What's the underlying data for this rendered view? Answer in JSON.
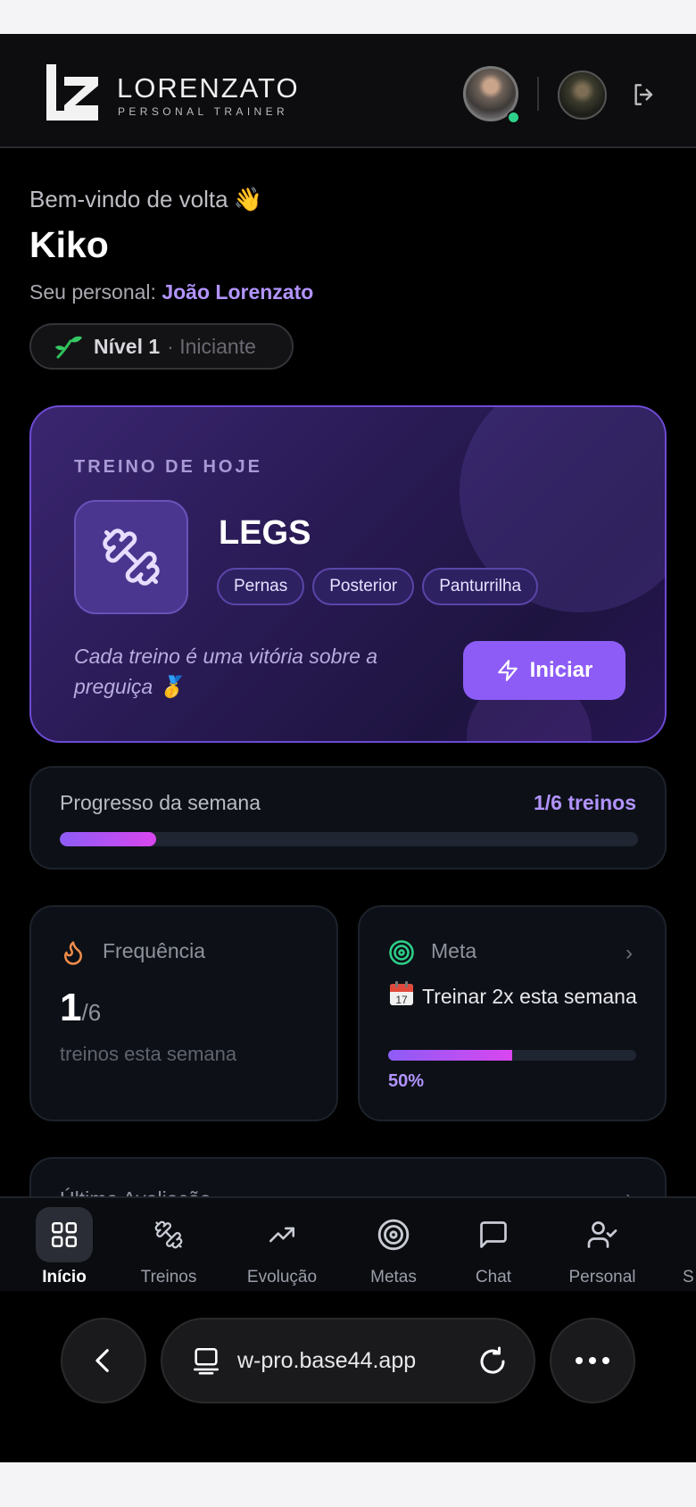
{
  "header": {
    "brand_name": "LORENZATO",
    "brand_sub": "PERSONAL TRAINER"
  },
  "welcome": {
    "greeting": "Bem-vindo de volta",
    "wave_emoji": "👋",
    "user_name": "Kiko",
    "trainer_prefix": "Seu personal:",
    "trainer_name": "João Lorenzato",
    "level_label": "Nível 1",
    "level_rank": "· Iniciante"
  },
  "today_workout": {
    "kicker": "TREINO DE HOJE",
    "title": "LEGS",
    "tags": [
      "Pernas",
      "Posterior",
      "Panturrilha"
    ],
    "quote": "Cada treino é uma vitória sobre a preguiça 🥇",
    "start_label": "Iniciar"
  },
  "week_progress": {
    "label": "Progresso da semana",
    "count": "1/6 treinos",
    "fraction": 0.1667
  },
  "frequency": {
    "title": "Frequência",
    "value": "1",
    "total": "/6",
    "subtitle": "treinos esta semana"
  },
  "goal": {
    "title": "Meta",
    "text": "Treinar 2x esta semana",
    "percent_label": "50%",
    "fraction": 0.5
  },
  "peek_card": {
    "title": "Última Avaliação"
  },
  "bottom_nav": {
    "items": [
      {
        "label": "Início",
        "icon": "grid-icon"
      },
      {
        "label": "Treinos",
        "icon": "dumbbell-icon"
      },
      {
        "label": "Evolução",
        "icon": "trend-up-icon"
      },
      {
        "label": "Metas",
        "icon": "target-icon"
      },
      {
        "label": "Chat",
        "icon": "chat-icon"
      },
      {
        "label": "Personal",
        "icon": "user-check-icon"
      },
      {
        "label": "S",
        "icon": ""
      }
    ],
    "active": "Início"
  },
  "browser": {
    "url": "w-pro.base44.app"
  },
  "colors": {
    "accent": "#8d5cf6",
    "accent_text": "#b294ff",
    "online": "#2ed18a",
    "flame": "#f28c4a",
    "target": "#2ed18a"
  }
}
